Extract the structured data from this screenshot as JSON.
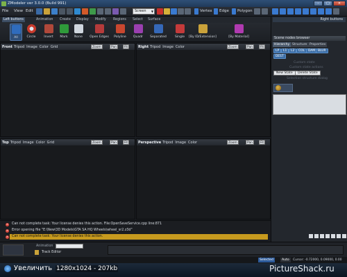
{
  "window": {
    "title": "ZModeler ver 3.0.0 (Build 991)",
    "buttons": [
      "–",
      "□",
      "×"
    ]
  },
  "menu": {
    "items": [
      "File",
      "View",
      "Edit"
    ],
    "select_mode": "Screen",
    "vertex_label": "Vertex",
    "edge_label": "Edge",
    "polygon_label": "Polygon"
  },
  "tabs": {
    "items": [
      "Left buttons",
      "Animation",
      "Create",
      "Display",
      "Modify",
      "Regions",
      "Select",
      "Surface"
    ],
    "active_index": 0,
    "right_header": "Right buttons"
  },
  "tools": [
    {
      "label": "All",
      "icon": "select-all-icon",
      "color": "#2f6cbd"
    },
    {
      "label": "Circle",
      "icon": "circle-select-icon",
      "color": "#c93a2c"
    },
    {
      "label": "Invert",
      "icon": "invert-icon",
      "color": "#b0483a"
    },
    {
      "label": "Mark",
      "icon": "mark-icon",
      "color": "#2f9a3a"
    },
    {
      "label": "None",
      "icon": "none-icon",
      "color": "#d0d6de"
    },
    {
      "label": "Open Edges",
      "icon": "open-edges-icon",
      "color": "#b53b3b"
    },
    {
      "label": "Polyline",
      "icon": "polyline-icon",
      "color": "#c9472f"
    },
    {
      "label": "Quadr",
      "icon": "quadr-icon",
      "color": "#9a3fb0"
    },
    {
      "label": "Separated",
      "icon": "separated-icon",
      "color": "#3568b8"
    },
    {
      "label": "Single",
      "icon": "single-icon",
      "color": "#c43a3a"
    },
    {
      "label": "[By ID/Extension]",
      "icon": "by-id-icon",
      "color": "#caa23a"
    },
    {
      "label": "[By Material]",
      "icon": "by-material-icon",
      "color": "#b03ab0"
    }
  ],
  "viewports": [
    {
      "name": "Front",
      "menus": [
        "Tripod",
        "Image",
        "Color",
        "Grid"
      ],
      "zoom": "Zoom",
      "pan": "Pan",
      "fit": "Fit"
    },
    {
      "name": "Right",
      "menus": [
        "Tripod",
        "Image",
        "Color"
      ],
      "zoom": "Zoom",
      "pan": "Pan",
      "fit": "Fit"
    },
    {
      "name": "Top",
      "menus": [
        "Tripod",
        "Image",
        "Color",
        "Grid"
      ],
      "zoom": "Zoom",
      "pan": "Pan",
      "fit": "Fit"
    },
    {
      "name": "Perspective",
      "menus": [
        "Tripod",
        "Image",
        "Color"
      ],
      "zoom": "Zoom",
      "pan": "Pan",
      "fit": "Fit"
    }
  ],
  "right_panel": {
    "header": "Right buttons",
    "browser_title": "Scene nodes browser",
    "tabs": [
      "Hierarchy",
      "Structure",
      "Properties"
    ],
    "active_tab": 0,
    "chips": [
      "LP",
      "L1",
      "L2",
      "COL",
      "DAM",
      "BLUR",
      "DEST"
    ],
    "custom_state": "Custom state",
    "custom_state_actions": "Custom state actions",
    "new_state": "New State",
    "delete_state": "Delete State",
    "selection_structure": "Selection structure dialog"
  },
  "log": {
    "lines": [
      "Can not complete task: Your license denies this action. File:OpenSaveService.cpp line:871",
      "Error opening file \"E:\\New\\3D Models\\GTA SA HQ Wheels\\wheel_sr2.z3d\"",
      "Can not complete task: Your license denies this action."
    ],
    "highlight_index": 2
  },
  "animation": {
    "label": "Animation",
    "track_editor": "Track Editor"
  },
  "status": {
    "mode": "Selected",
    "auto": "Auto",
    "cursor": "Cursor: -0.72000, 0.09000, 0.00"
  },
  "overlay": {
    "zoom_text": "Увеличить",
    "size_text": "1280x1024 - 207kb",
    "watermark": "PictureShack.ru"
  }
}
